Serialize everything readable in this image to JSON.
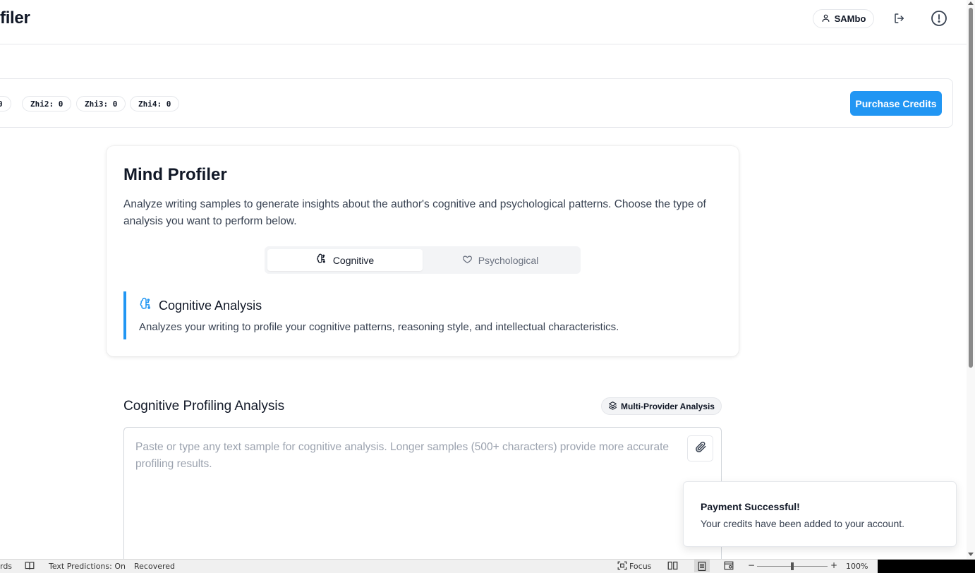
{
  "header": {
    "brand": "filer",
    "user": "SAMbo",
    "icons": [
      "user-icon",
      "logout-icon",
      "alert-circle-icon"
    ]
  },
  "credits": {
    "pills": [
      "0",
      "Zhi2: 0",
      "Zhi3: 0",
      "Zhi4: 0"
    ],
    "purchase_label": "Purchase Credits"
  },
  "card": {
    "title": "Mind Profiler",
    "description": "Analyze writing samples to generate insights about the author's cognitive and psychological patterns. Choose the type of analysis you want to perform below.",
    "tabs": [
      {
        "label": "Cognitive",
        "icon": "brain-icon",
        "active": true
      },
      {
        "label": "Psychological",
        "icon": "heart-icon",
        "active": false
      }
    ],
    "info": {
      "title": "Cognitive Analysis",
      "text": "Analyzes your writing to profile your cognitive patterns, reasoning style, and intellectual characteristics."
    }
  },
  "analysis": {
    "title": "Cognitive Profiling Analysis",
    "badge": "Multi-Provider Analysis",
    "placeholder": "Paste or type any text sample for cognitive analysis. Longer samples (500+ characters) provide more accurate profiling results.",
    "value": ""
  },
  "toast": {
    "title": "Payment Successful!",
    "text": "Your credits have been added to your account."
  },
  "statusbar": {
    "words": "rds",
    "text_predictions": "Text Predictions: On",
    "recovered": "Recovered",
    "focus": "Focus",
    "zoom": "100%",
    "zoom_minus": "−",
    "zoom_plus": "+"
  },
  "colors": {
    "accent": "#2196f3",
    "text": "#111827",
    "muted": "#6b7280",
    "border": "#e5e7eb"
  }
}
